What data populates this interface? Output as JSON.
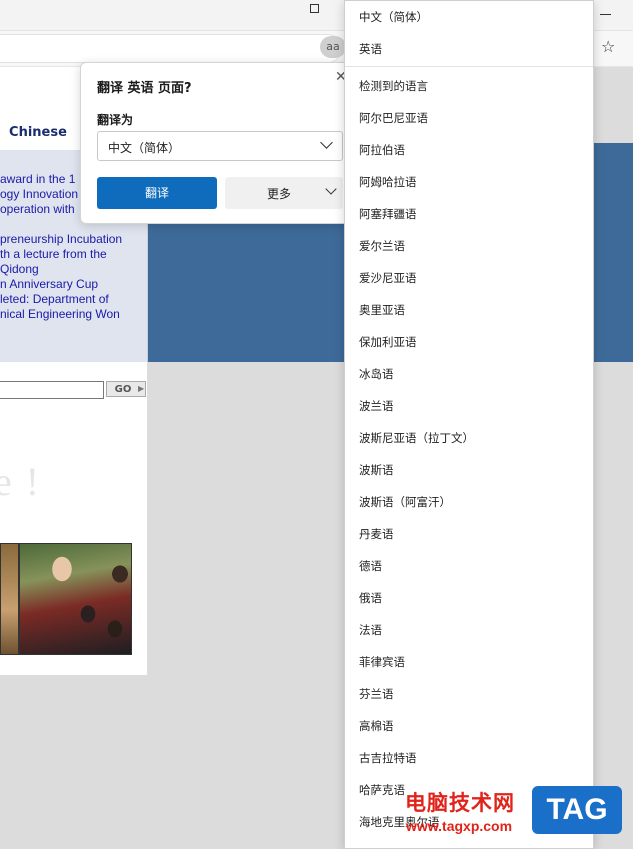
{
  "browser": {
    "read_aloud_label": "aa"
  },
  "webpage": {
    "tab_label": "Chinese",
    "news_lines": [
      "award in the 1",
      "ogy Innovation",
      "operation with",
      "",
      "preneurship Incubation",
      "th a lecture from the",
      "Qidong",
      "n Anniversary Cup",
      "leted: Department of",
      "nical Engineering Won"
    ],
    "search_button_label": "GO"
  },
  "translate_popup": {
    "title": "翻译 英语 页面?",
    "translate_to_label": "翻译为",
    "selected_language": "中文（简体）",
    "translate_button": "翻译",
    "more_button": "更多"
  },
  "language_dropdown": {
    "pinned": [
      "中文（简体）",
      "英语"
    ],
    "items": [
      "检测到的语言",
      "阿尔巴尼亚语",
      "阿拉伯语",
      "阿姆哈拉语",
      "阿塞拜疆语",
      "爱尔兰语",
      "爱沙尼亚语",
      "奥里亚语",
      "保加利亚语",
      "冰岛语",
      "波兰语",
      "波斯尼亚语（拉丁文）",
      "波斯语",
      "波斯语（阿富汗）",
      "丹麦语",
      "德语",
      "俄语",
      "法语",
      "菲律宾语",
      "芬兰语",
      "高棉语",
      "古吉拉特语",
      "哈萨克语",
      "海地克里奥尔语"
    ]
  },
  "watermark": {
    "text": "电脑技术网",
    "url": "www.tagxp.com",
    "logo": "TAG"
  }
}
